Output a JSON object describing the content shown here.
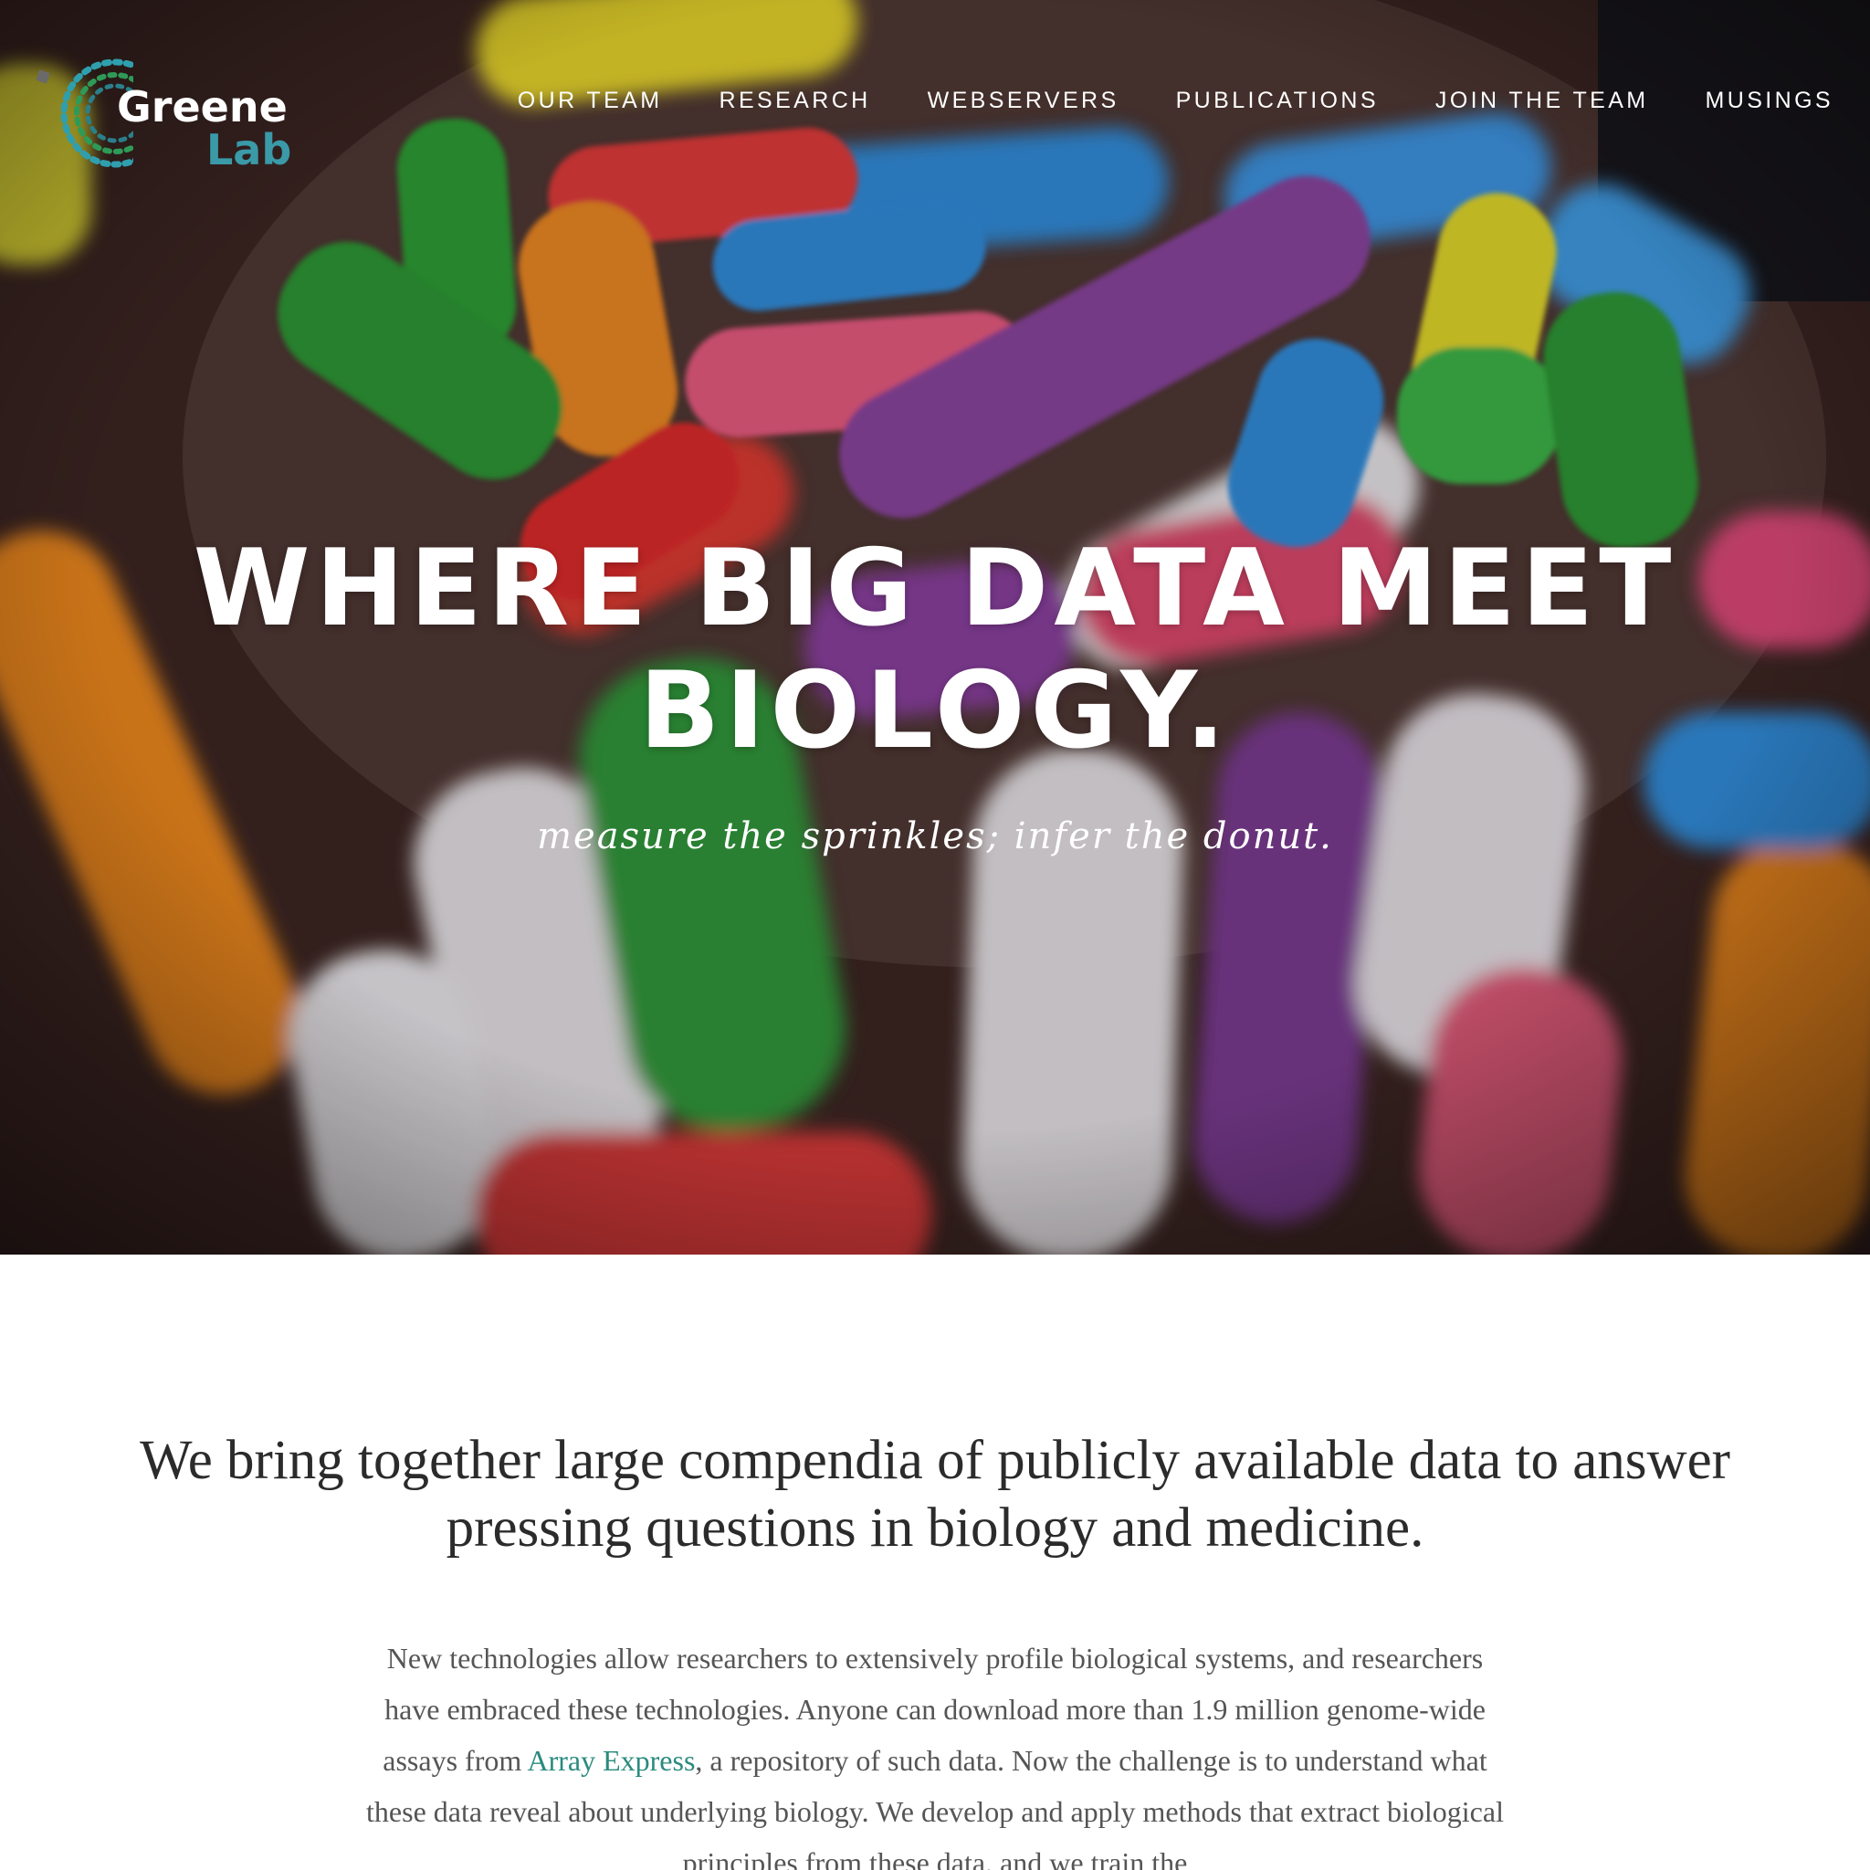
{
  "logo": {
    "name_line1": "Greene",
    "name_line2": "Lab",
    "accent_color": "#3a9aa8",
    "mark_colors": [
      "#2a7f8a",
      "#3aa3b0",
      "#2f9a57",
      "#6a6a6a"
    ]
  },
  "nav": {
    "items": [
      {
        "label": "OUR TEAM"
      },
      {
        "label": "RESEARCH"
      },
      {
        "label": "WEBSERVERS"
      },
      {
        "label": "PUBLICATIONS"
      },
      {
        "label": "JOIN THE TEAM"
      },
      {
        "label": "MUSINGS"
      }
    ]
  },
  "hero": {
    "title_line1": "WHERE BIG DATA MEET",
    "title_line2": "BIOLOGY.",
    "tagline": "measure the sprinkles; infer the donut."
  },
  "intro": {
    "heading": "We bring together large compendia of publicly available data to answer pressing questions in biology and medicine.",
    "body_before_link": "New technologies allow researchers to extensively profile biological systems, and researchers have embraced these technologies. Anyone can download more than 1.9 million genome-wide assays from ",
    "link_text": "Array Express",
    "body_after_link": ", a repository of such data. Now the challenge is to understand what these data reveal about underlying biology. We develop and apply methods that extract biological principles from these data, and we train the",
    "link_color": "#2a8b7e"
  }
}
